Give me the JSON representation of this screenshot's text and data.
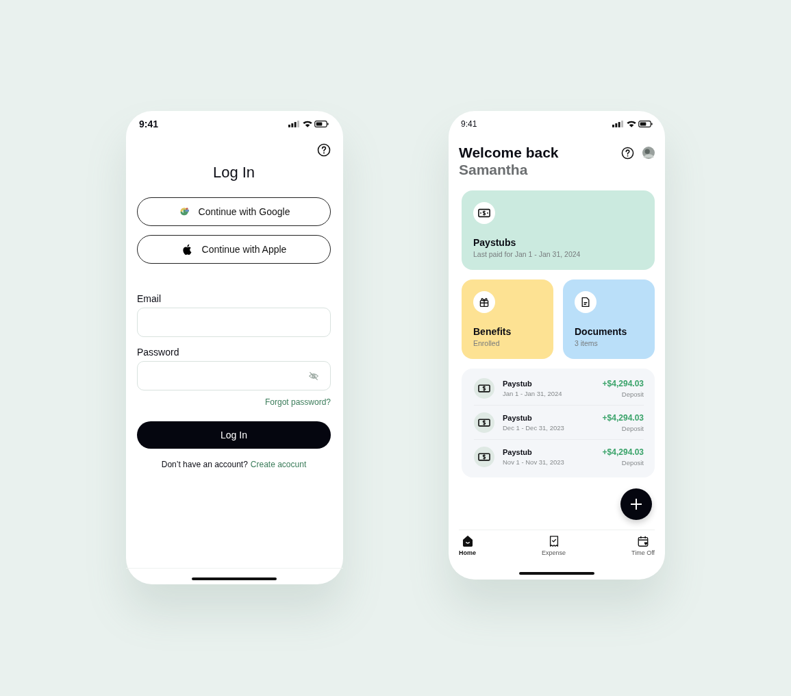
{
  "login_screen": {
    "status_bar": {
      "time": "9:41"
    },
    "title": "Log In",
    "social_buttons": [
      {
        "kind": "google",
        "label": "Continue with Google"
      },
      {
        "kind": "apple",
        "label": "Continue with Apple"
      }
    ],
    "fields": [
      {
        "kind": "text",
        "label": "Email"
      },
      {
        "kind": "password",
        "label": "Password"
      }
    ],
    "forgot_link": "Forgot password?",
    "submit": "Log In",
    "signup_prompt": "Don’t have an account?",
    "signup_link": "Create acocunt"
  },
  "home_screen": {
    "status_bar": {
      "time": "9:41"
    },
    "greeting": "Welcome back",
    "name": "Samantha",
    "cards": [
      {
        "kind": "paystubs",
        "title": "Paystubs",
        "subtitle": "Last paid for Jan 1 - Jan 31, 2024",
        "color": "#cbeadf"
      },
      {
        "kind": "benefits",
        "title": "Benefits",
        "subtitle": "Enrolled",
        "color": "#fde293"
      },
      {
        "kind": "documents",
        "title": "Documents",
        "subtitle": "3 items",
        "color": "#badff9"
      }
    ],
    "transactions": [
      {
        "title": "Paystub",
        "dates": "Jan 1 - Jan 31, 2024",
        "amount": "+$4,294.03",
        "type": "Deposit"
      },
      {
        "title": "Paystub",
        "dates": "Dec 1 - Dec 31, 2023",
        "amount": "+$4,294.03",
        "type": "Deposit"
      },
      {
        "title": "Paystub",
        "dates": "Nov 1 - Nov 31, 2023",
        "amount": "+$4,294.03",
        "type": "Deposit"
      }
    ],
    "nav": [
      {
        "kind": "home",
        "label": "Home",
        "selected": true
      },
      {
        "kind": "expense",
        "label": "Expense",
        "selected": false
      },
      {
        "kind": "timeoff",
        "label": "Time Off",
        "selected": false
      }
    ]
  }
}
